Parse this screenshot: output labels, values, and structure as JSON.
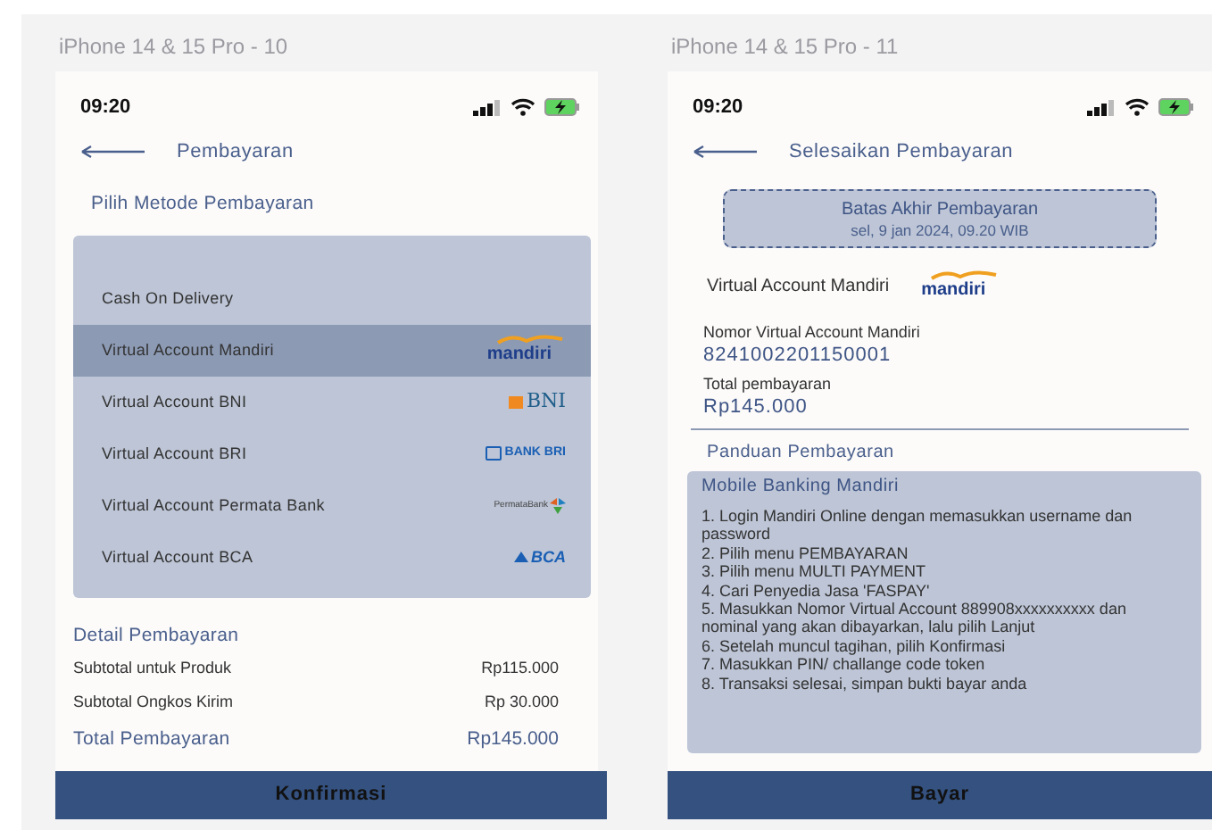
{
  "payment_screen": {
    "frame_label": "iPhone 14 & 15 Pro - 10",
    "time": "09:20",
    "title": "Pembayaran",
    "section_title": "Pilih Metode Pembayaran",
    "methods": [
      {
        "label": "Cash On Delivery",
        "selected": false
      },
      {
        "label": "Virtual Account Mandiri",
        "selected": true,
        "logo": {
          "kind": "mandiri",
          "text": "mandiri"
        }
      },
      {
        "label": "Virtual Account BNI",
        "selected": false,
        "logo": {
          "kind": "bni",
          "text": "BNI"
        }
      },
      {
        "label": "Virtual Account BRI",
        "selected": false,
        "logo": {
          "kind": "bri",
          "text": "BANK BRI"
        }
      },
      {
        "label": "Virtual Account Permata Bank",
        "selected": false,
        "logo": {
          "kind": "permata",
          "text": "PermataBank"
        }
      },
      {
        "label": "Virtual Account BCA",
        "selected": false,
        "logo": {
          "kind": "bca",
          "text": "BCA"
        }
      }
    ],
    "detail_title": "Detail Pembayaran",
    "details": [
      {
        "label": "Subtotal untuk Produk",
        "value": "Rp115.000",
        "total": false
      },
      {
        "label": "Subtotal Ongkos Kirim",
        "value": "Rp 30.000",
        "total": false
      },
      {
        "label": "Total Pembayaran",
        "value": "Rp145.000",
        "total": true
      }
    ],
    "button": "Konfirmasi"
  },
  "finish_screen": {
    "frame_label": "iPhone 14 & 15 Pro - 11",
    "time": "09:20",
    "title": "Selesaikan Pembayaran",
    "deadline": {
      "title": "Batas Akhir Pembayaran",
      "date": "sel, 9 jan 2024, 09.20 WIB"
    },
    "method": "Virtual Account Mandiri",
    "method_logo": "mandiri",
    "va_label": "Nomor Virtual Account Mandiri",
    "va_number": "8241002201150001",
    "total_label": "Total pembayaran",
    "total_value": "Rp145.000",
    "guide_title": "Panduan Pembayaran",
    "guide_subtitle": "Mobile Banking Mandiri",
    "steps": [
      "1. Login Mandiri Online dengan memasukkan username dan password",
      "2. Pilih menu PEMBAYARAN",
      "3. Pilih menu MULTI PAYMENT",
      "4. Cari Penyedia Jasa 'FASPAY'",
      "5. Masukkan Nomor Virtual Account 889908xxxxxxxxxx dan nominal yang akan dibayarkan, lalu pilih Lanjut",
      "6. Setelah muncul tagihan, pilih Konfirmasi",
      "7. Masukkan PIN/ challange code token",
      "8. Transaksi selesai, simpan bukti bayar anda"
    ],
    "button": "Bayar"
  }
}
